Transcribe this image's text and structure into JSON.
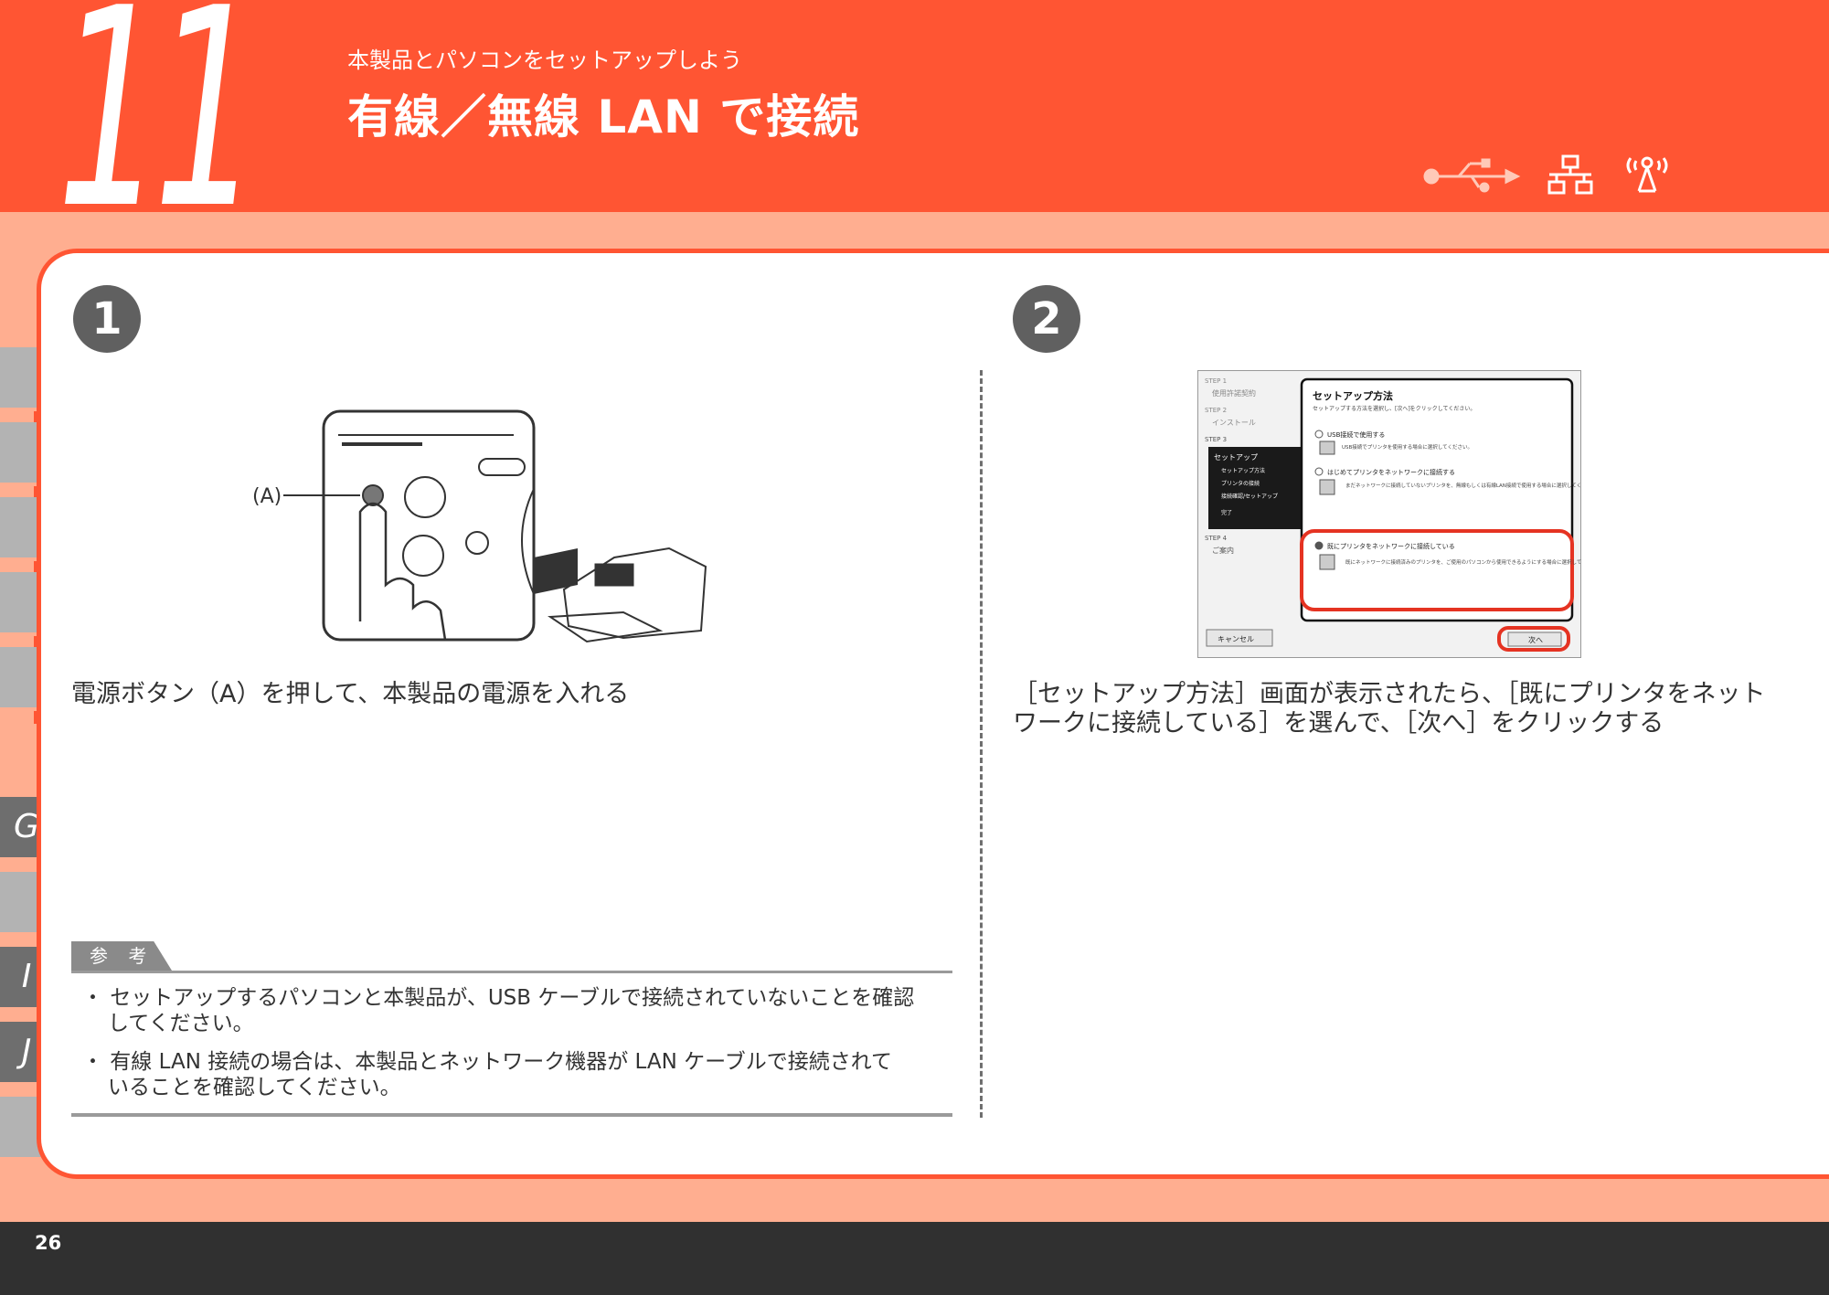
{
  "header": {
    "section_number": "11",
    "subtitle": "本製品とパソコンをセットアップしよう",
    "title": "有線／無線 LAN で接続",
    "connection_icons": [
      "usb-icon",
      "wired-lan-icon",
      "wireless-lan-icon"
    ]
  },
  "side_tabs": [
    {
      "label": ""
    },
    {
      "label": ""
    },
    {
      "label": ""
    },
    {
      "label": ""
    },
    {
      "label": ""
    },
    {
      "label": "G"
    },
    {
      "label": ""
    },
    {
      "label": "I"
    },
    {
      "label": "J"
    },
    {
      "label": ""
    }
  ],
  "step1": {
    "number": "1",
    "callout_label": "(A)",
    "instruction": "電源ボタン（A）を押して、本製品の電源を入れる"
  },
  "step2": {
    "number": "2",
    "instruction_line1": "［セットアップ方法］画面が表示されたら、［既にプリンタをネット",
    "instruction_line2": "ワークに接続している］を選んで、［次へ］をクリックする",
    "dialog": {
      "sidebar_steps": [
        {
          "step": "STEP 1",
          "label": "使用許諾契約"
        },
        {
          "step": "STEP 2",
          "label": "インストール"
        },
        {
          "step": "STEP 3",
          "label": "セットアップ"
        },
        {
          "step": "STEP 4",
          "label": "ご案内"
        }
      ],
      "sidebar_sub_items": [
        "セットアップ方法",
        "プリンタの接続",
        "接続確認/セットアップ",
        "完了"
      ],
      "title": "セットアップ方法",
      "description": "セットアップする方法を選択し、[次へ]をクリックしてください。",
      "options": [
        {
          "label": "USB接続で使用する",
          "desc": "USB接続でプリンタを使用する場合に選択してください。"
        },
        {
          "label": "はじめてプリンタをネットワークに接続する",
          "desc": "まだネットワークに接続していないプリンタを、無線もしくは有線LAN接続で使用する場合に選択してください。"
        },
        {
          "label": "既にプリンタをネットワークに接続している",
          "desc": "既にネットワークに接続済みのプリンタを、ご使用のパソコンから使用できるようにする場合に選択してください。"
        }
      ],
      "cancel_button": "キャンセル",
      "next_button": "次へ"
    }
  },
  "note": {
    "label": "参 考",
    "items": [
      {
        "line1": "・ セットアップするパソコンと本製品が、USB ケーブルで接続されていないことを確認",
        "line2": "してください。"
      },
      {
        "line1": "・ 有線 LAN 接続の場合は、本製品とネットワーク機器が LAN ケーブルで接続されて",
        "line2": "いることを確認してください。"
      }
    ]
  },
  "footer": {
    "page_number": "26"
  },
  "colors": {
    "accent": "#ff5533",
    "band": "#ffae90",
    "footer": "#303030",
    "tab": "#b3b3b3"
  }
}
